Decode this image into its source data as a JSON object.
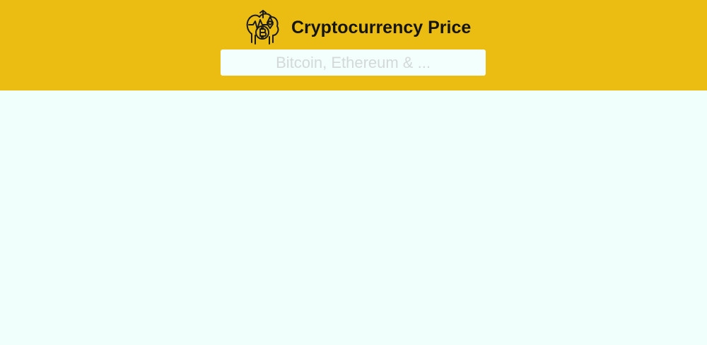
{
  "header": {
    "title": "Cryptocurrency Price",
    "logo_icon": "bitcoin-ethereum-brain-icon",
    "background_color": "#ebbd12"
  },
  "search": {
    "placeholder": "Bitcoin, Ethereum & ...",
    "value": ""
  },
  "main": {
    "background_color": "#f0fffb"
  }
}
